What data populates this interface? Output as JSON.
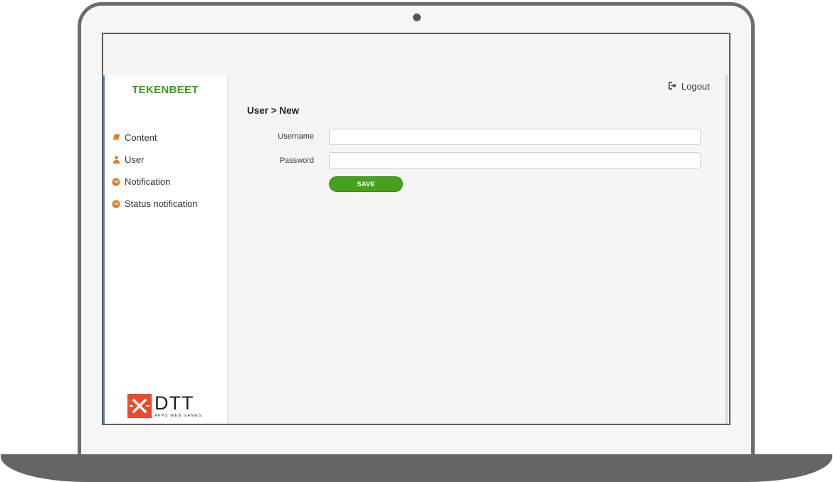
{
  "sidebar": {
    "brand": "TEKENBEET",
    "items": [
      {
        "label": "Content",
        "icon": "book-icon"
      },
      {
        "label": "User",
        "icon": "user-icon"
      },
      {
        "label": "Notification",
        "icon": "gauge-icon"
      },
      {
        "label": "Status notification",
        "icon": "gauge-icon"
      }
    ],
    "logo": {
      "main": "DTT",
      "tagline": "APPS WEB GAMES"
    }
  },
  "header": {
    "logout_label": "Logout",
    "logout_icon": "sign-out-icon"
  },
  "main": {
    "title": "User > New",
    "form": {
      "username_label": "Username",
      "username_value": "",
      "password_label": "Password",
      "password_value": "",
      "save_label": "SAVE"
    }
  },
  "colors": {
    "brand": "#3a9a1f",
    "accent_orange": "#e07a1f",
    "save_button": "#46a11d",
    "logo_red": "#e84c2e",
    "frame": "#6d6d6d"
  }
}
